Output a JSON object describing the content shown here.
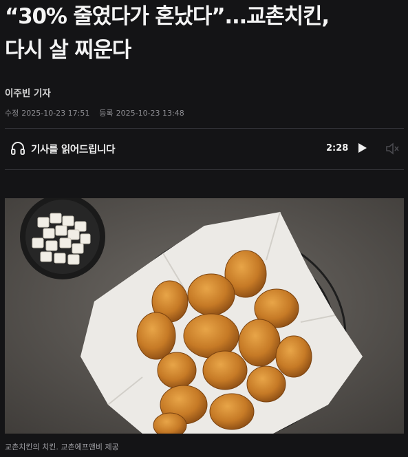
{
  "article": {
    "title_line1": "“30% 줄였다가 혼났다”...교촌치킨,",
    "title_line2": "다시 살 찌운다",
    "reporter": "이주빈 기자",
    "modified_label": "수정",
    "modified_date": "2025-10-23 17:51",
    "registered_label": "등록",
    "registered_date": "2025-10-23 13:48"
  },
  "audio": {
    "label": "기사를 읽어드립니다",
    "duration": "2:28",
    "play_icon": "play-icon",
    "volume_icon": "volume-muted-icon",
    "headphone_icon": "headphone-icon"
  },
  "photo": {
    "caption": "교촌치킨의 치킨. 교촌에프앤비 제공"
  },
  "colors": {
    "background": "#141416",
    "text_primary": "#f4f4f4",
    "text_muted": "#8e8e93",
    "divider": "#333338"
  }
}
